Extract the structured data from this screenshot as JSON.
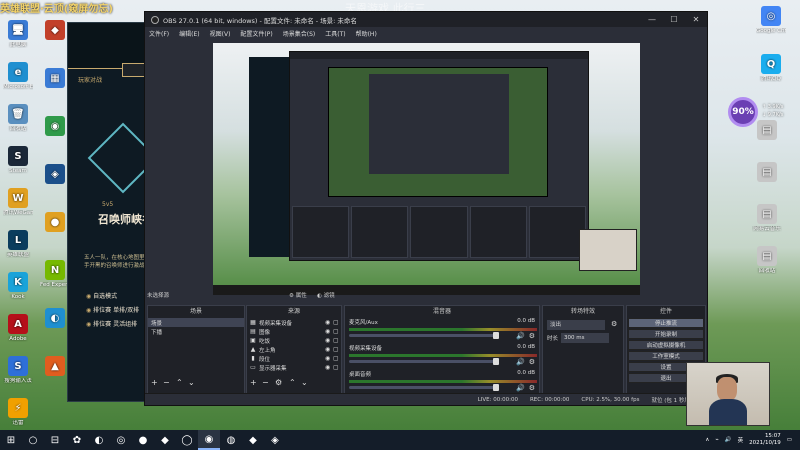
{
  "desktop": {
    "watermark": "天恩游戏 此行三",
    "corner_title": "英雄联盟·云顶(窥屏勿忘)",
    "left_icons": [
      {
        "label": "此电脑",
        "color": "#3a7bd5",
        "glyph": "🖥"
      },
      {
        "label": "Microsoft Edge",
        "color": "#1f8fd0",
        "glyph": "e"
      },
      {
        "label": "回收站",
        "color": "#5a8fbf",
        "glyph": "🗑"
      },
      {
        "label": "Steam",
        "color": "#1b2838",
        "glyph": "S"
      },
      {
        "label": "腾讯WeGame",
        "color": "#e0a020",
        "glyph": "W"
      },
      {
        "label": "英雄联盟",
        "color": "#0b3c5d",
        "glyph": "L"
      },
      {
        "label": "Kook",
        "color": "#1aa3d9",
        "glyph": "K"
      },
      {
        "label": "Adobe",
        "color": "#b5101a",
        "glyph": "A"
      },
      {
        "label": "搜狗输入法",
        "color": "#2e6fd8",
        "glyph": "S"
      },
      {
        "label": "迅雷",
        "color": "#f0a000",
        "glyph": "⚡"
      }
    ],
    "second_icons": [
      {
        "label": "",
        "color": "#c2402a",
        "glyph": "◆"
      },
      {
        "label": "",
        "color": "#3a7bd5",
        "glyph": "▦"
      },
      {
        "label": "",
        "color": "#2f9a4a",
        "glyph": "◉"
      },
      {
        "label": "",
        "color": "#1b4f8a",
        "glyph": "◈"
      },
      {
        "label": "",
        "color": "#e0a020",
        "glyph": "●"
      },
      {
        "label": "Fed Experience",
        "color": "#76b900",
        "glyph": "N"
      },
      {
        "label": "",
        "color": "#1f8fd0",
        "glyph": "◐"
      },
      {
        "label": "",
        "color": "#e05d1f",
        "glyph": "▲"
      }
    ],
    "right_icons": [
      {
        "label": "Google Chrome",
        "color": "#4285f4",
        "glyph": "◎"
      },
      {
        "label": "腾讯QQ",
        "color": "#1aadee",
        "glyph": "Q"
      },
      {
        "label": "",
        "color": "#c6c6c6",
        "glyph": "▤"
      },
      {
        "label": "",
        "color": "#c6c6c6",
        "glyph": "▤"
      },
      {
        "label": "网易云音乐",
        "color": "#c6c6c6",
        "glyph": "▤"
      },
      {
        "label": "回收站",
        "color": "#c6c6c6",
        "glyph": "▤"
      }
    ],
    "speed_widget": {
      "percent": "90%",
      "up": "↑ 3.9K/s",
      "down": "↓ 9.7K/s"
    }
  },
  "lol": {
    "pvp_label": "玩家对战",
    "mode_title": "5v5",
    "map_name": "召唤师峡谷",
    "description": "五人一队，在核心地图里带着 手开黑的召唤师进行激战",
    "modes": [
      "自选模式",
      "排位赛 单排/双排",
      "排位赛 灵活组排"
    ],
    "back_button": "PLAY"
  },
  "obs": {
    "title": "OBS 27.0.1 (64 bit, windows) - 配置文件: 未命名 - 场景: 未命名",
    "menu": [
      "文件(F)",
      "编辑(E)",
      "视图(V)",
      "配置文件(P)",
      "场景集合(S)",
      "工具(T)",
      "帮助(H)"
    ],
    "preview_label": "未选择源",
    "preview_tools": [
      "属性",
      "滤镜"
    ],
    "scenes": {
      "title": "场景",
      "items": [
        "场景",
        "下播"
      ]
    },
    "sources": {
      "title": "来源",
      "items": [
        {
          "icon": "▦",
          "label": "视频采集设备"
        },
        {
          "icon": "▤",
          "label": "图像"
        },
        {
          "icon": "▣",
          "label": "吃饭"
        },
        {
          "icon": "▲",
          "label": "左上角"
        },
        {
          "icon": "▮",
          "label": "段位"
        },
        {
          "icon": "▭",
          "label": "显示器采集"
        }
      ]
    },
    "mixer": {
      "title": "混音器",
      "channels": [
        {
          "name": "麦克风/Aux",
          "db": "0.0 dB"
        },
        {
          "name": "视频采集设备",
          "db": "0.0 dB"
        },
        {
          "name": "桌面音频",
          "db": "0.0 dB"
        }
      ]
    },
    "transitions": {
      "title": "转场特效",
      "type": "淡出",
      "duration_label": "时长",
      "duration_value": "300 ms"
    },
    "controls": {
      "title": "控件",
      "buttons": [
        "停止推流",
        "开始录制",
        "启动虚拟摄像机",
        "工作室模式",
        "设置",
        "退出"
      ]
    },
    "status": {
      "live": "LIVE: 00:00:00",
      "rec": "REC: 00:00:00",
      "cpu": "CPU: 2.5%, 30.00 fps",
      "extra": "就位 (包 1 秒后开始)"
    }
  },
  "taskbar": {
    "items": [
      "⊞",
      "○",
      "⊟",
      "✿",
      "◐",
      "◎",
      "●",
      "◆",
      "◯",
      "◉",
      "◍",
      "◆",
      "◈"
    ],
    "tray": {
      "lang": "英",
      "time": "15:07",
      "date": "2021/10/19"
    }
  }
}
